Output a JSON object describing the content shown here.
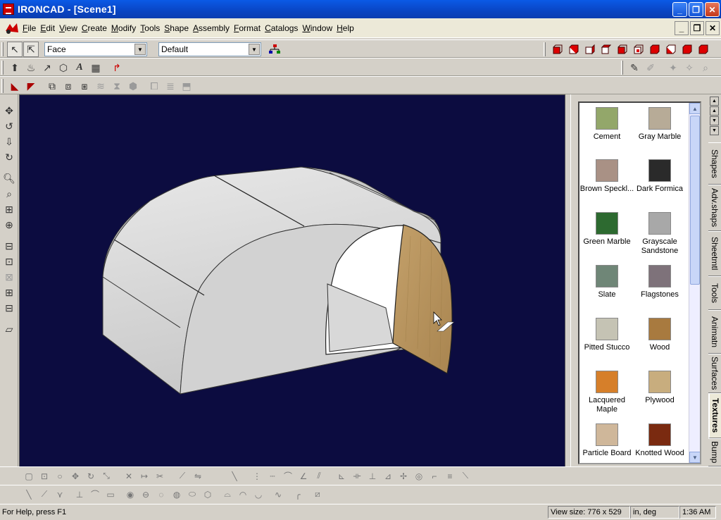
{
  "window": {
    "title": "IRONCAD - [Scene1]"
  },
  "menu": [
    "File",
    "Edit",
    "View",
    "Create",
    "Modify",
    "Tools",
    "Shape",
    "Assembly",
    "Format",
    "Catalogs",
    "Window",
    "Help"
  ],
  "toolbar": {
    "selection_mode": "Face",
    "style_value": "Default"
  },
  "catalog": {
    "items": [
      {
        "label": "Cement",
        "color": "#93a76a"
      },
      {
        "label": "Gray Marble",
        "color": "#b7ab97"
      },
      {
        "label": "Brown Speckl...",
        "color": "#a99185"
      },
      {
        "label": "Dark Formica",
        "color": "#2a2a2a"
      },
      {
        "label": "Green Marble",
        "color": "#2d6a30"
      },
      {
        "label": "Grayscale Sandstone",
        "color": "#a8a8a8"
      },
      {
        "label": "Slate",
        "color": "#6f8677"
      },
      {
        "label": "Flagstones",
        "color": "#7e727a"
      },
      {
        "label": "Pitted Stucco",
        "color": "#c5c3b4"
      },
      {
        "label": "Wood",
        "color": "#a87a3f"
      },
      {
        "label": "Lacquered Maple",
        "color": "#d67f2a"
      },
      {
        "label": "Plywood",
        "color": "#c8ad7e"
      },
      {
        "label": "Particle Board",
        "color": "#cfb79a"
      },
      {
        "label": "Knotted Wood",
        "color": "#7a2a10"
      }
    ]
  },
  "side_tabs": [
    "Shapes",
    "Adv.shaps",
    "Sheetmtl",
    "Tools",
    "Animatn",
    "Surfaces",
    "Textures",
    "Bump"
  ],
  "status": {
    "help": "For Help, press F1",
    "view_size": "View size:  776 x  529",
    "units": "in, deg",
    "time": "1:36 AM"
  },
  "colors": {
    "viewport_bg": "#0c0c40",
    "door": "#b79660",
    "shell": "#d0d0d0"
  }
}
